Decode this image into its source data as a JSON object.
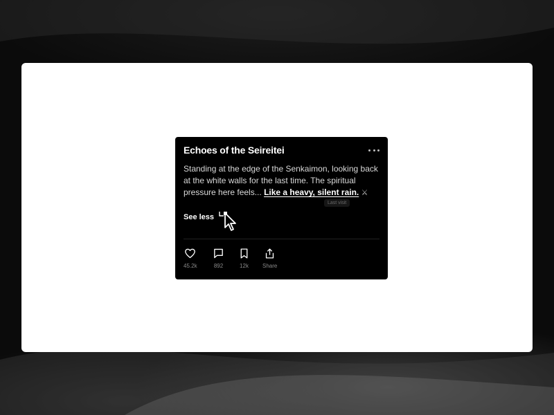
{
  "card": {
    "title": "Echoes of the Seireitei",
    "body_text": "Standing at the edge of the Senkaimon, looking back at the white walls for the last time. The spiritual pressure here feels... ",
    "body_emphasis": "Like a heavy, silent rain.",
    "body_emoji": "⚔",
    "tooltip": "Last visit",
    "see_less_label": "See less"
  },
  "actions": [
    {
      "name": "like",
      "icon": "heart-icon",
      "count": "45.2k"
    },
    {
      "name": "comment",
      "icon": "comment-icon",
      "count": "892"
    },
    {
      "name": "bookmark",
      "icon": "bookmark-icon",
      "count": "12k"
    },
    {
      "name": "share",
      "icon": "share-icon",
      "count": "Share"
    }
  ],
  "colors": {
    "card_bg": "#000000",
    "frame_bg": "#ffffff",
    "backdrop": "#0b0b0b",
    "muted_text": "#8a8a8a"
  }
}
